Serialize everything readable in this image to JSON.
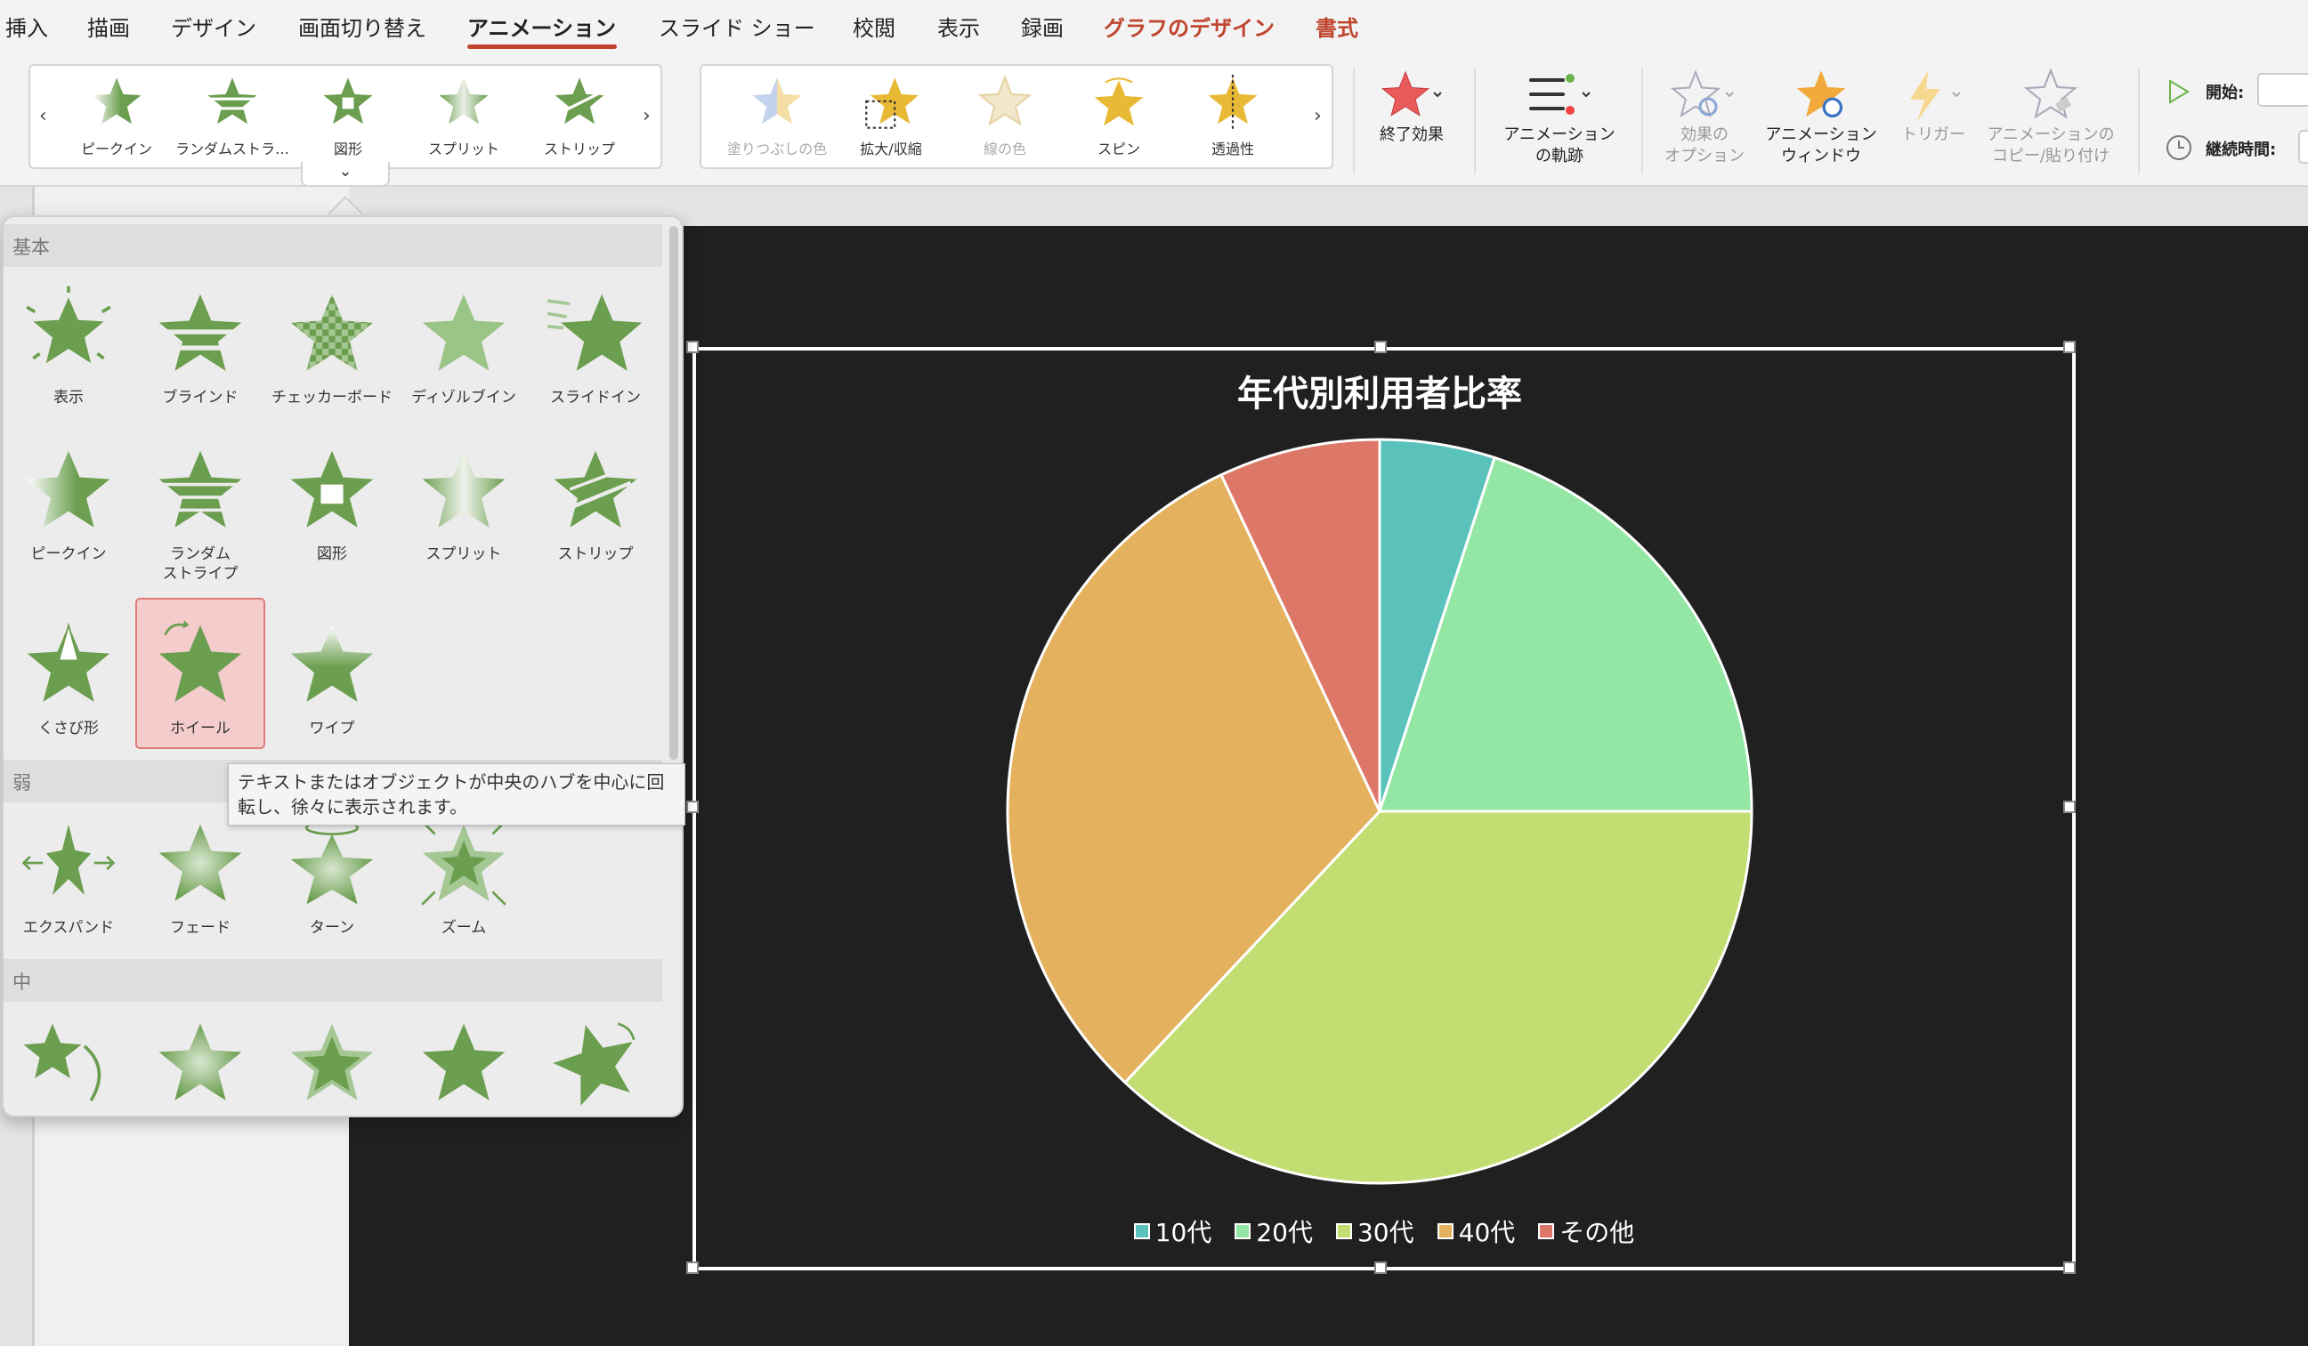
{
  "menu": {
    "tabs": [
      {
        "label": "挿入",
        "state": "normal"
      },
      {
        "label": "描画",
        "state": "normal"
      },
      {
        "label": "デザイン",
        "state": "normal"
      },
      {
        "label": "画面切り替え",
        "state": "normal"
      },
      {
        "label": "アニメーション",
        "state": "active"
      },
      {
        "label": "スライド ショー",
        "state": "normal"
      },
      {
        "label": "校閲",
        "state": "normal"
      },
      {
        "label": "表示",
        "state": "normal"
      },
      {
        "label": "録画",
        "state": "normal"
      },
      {
        "label": "グラフのデザイン",
        "state": "contextual"
      },
      {
        "label": "書式",
        "state": "contextual"
      }
    ]
  },
  "ribbon": {
    "entrance_gallery": [
      "ピークイン",
      "ランダムストラ…",
      "図形",
      "スプリット",
      "ストリップ"
    ],
    "emphasis_gallery": [
      "塗りつぶしの色",
      "拡大/収縮",
      "線の色",
      "スピン",
      "透過性"
    ],
    "buttons": {
      "exit_effect": "終了効果",
      "motion_path": [
        "アニメーション",
        "の軌跡"
      ],
      "effect_options": [
        "効果の",
        "オプション"
      ],
      "animation_pane": [
        "アニメーション",
        "ウィンドウ"
      ],
      "trigger": "トリガー",
      "animation_painter": [
        "アニメーションの",
        "コピー/貼り付け"
      ]
    },
    "timing": {
      "start_label": "開始:",
      "duration_label": "継続時間:"
    }
  },
  "panel": {
    "sections": {
      "basic": "基本",
      "subtle": "弱",
      "moderate": "中"
    },
    "basic_items": [
      {
        "label": "表示",
        "icon": "appear-star-icon"
      },
      {
        "label": "ブラインド",
        "icon": "blinds-star-icon"
      },
      {
        "label": "チェッカーボード",
        "icon": "checkerboard-star-icon"
      },
      {
        "label": "ディゾルブイン",
        "icon": "dissolve-star-icon"
      },
      {
        "label": "スライドイン",
        "icon": "fly-in-star-icon"
      },
      {
        "label": "ピークイン",
        "icon": "peek-in-star-icon"
      },
      {
        "label": "ランダム\nストライプ",
        "icon": "random-bars-star-icon"
      },
      {
        "label": "図形",
        "icon": "shape-star-icon"
      },
      {
        "label": "スプリット",
        "icon": "split-star-icon"
      },
      {
        "label": "ストリップ",
        "icon": "strips-star-icon"
      },
      {
        "label": "くさび形",
        "icon": "wedge-star-icon"
      },
      {
        "label": "ホイール",
        "icon": "wheel-star-icon",
        "selected": true
      },
      {
        "label": "ワイプ",
        "icon": "wipe-star-icon"
      }
    ],
    "subtle_items": [
      {
        "label": "エクスパンド",
        "icon": "expand-star-icon"
      },
      {
        "label": "フェード",
        "icon": "fade-star-icon"
      },
      {
        "label": "ターン",
        "icon": "turn-star-icon"
      },
      {
        "label": "ズーム",
        "icon": "zoom-star-icon"
      }
    ],
    "tooltip": "テキストまたはオブジェクトが中央のハブを中心に回転し、徐々に表示されます。"
  },
  "colors": {
    "accent": "#c0442d",
    "star_green": "#6b9e4f"
  },
  "chart_data": {
    "type": "pie",
    "title": "年代別利用者比率",
    "categories": [
      "10代",
      "20代",
      "30代",
      "40代",
      "その他"
    ],
    "values": [
      5,
      20,
      37,
      31,
      7
    ],
    "colors": [
      "#5bc2bb",
      "#93e6a3",
      "#c2de72",
      "#e4b25e",
      "#dd7767"
    ],
    "legend_position": "bottom"
  }
}
